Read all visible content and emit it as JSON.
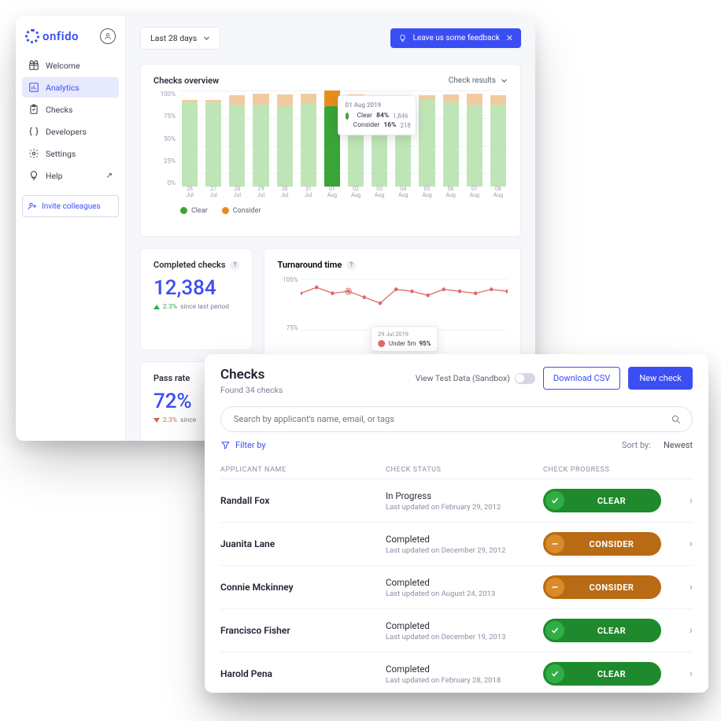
{
  "brand": {
    "name": "onfido"
  },
  "sidebar": {
    "items": [
      {
        "label": "Welcome",
        "icon": "gift-icon"
      },
      {
        "label": "Analytics",
        "icon": "bar-chart-icon",
        "active": true
      },
      {
        "label": "Checks",
        "icon": "clipboard-icon"
      },
      {
        "label": "Developers",
        "icon": "braces-icon"
      },
      {
        "label": "Settings",
        "icon": "gear-icon"
      },
      {
        "label": "Help",
        "icon": "bulb-icon",
        "external": true
      }
    ],
    "invite_label": "Invite colleagues"
  },
  "toolbar": {
    "range_label": "Last 28 days",
    "feedback_label": "Leave us some feedback"
  },
  "overview": {
    "title": "Checks overview",
    "results_label": "Check results",
    "y_ticks": [
      "100%",
      "75%",
      "50%",
      "25%",
      "0%"
    ],
    "legend_clear": "Clear",
    "legend_consider": "Consider"
  },
  "chart_data": {
    "type": "bar",
    "y_axis": "percent",
    "ylim": [
      0,
      100
    ],
    "categories": [
      {
        "d": "26",
        "m": "Jul"
      },
      {
        "d": "27",
        "m": "Jul"
      },
      {
        "d": "28",
        "m": "Jul"
      },
      {
        "d": "29",
        "m": "Jul"
      },
      {
        "d": "30",
        "m": "Jul"
      },
      {
        "d": "31",
        "m": "Jul"
      },
      {
        "d": "01",
        "m": "Aug"
      },
      {
        "d": "02",
        "m": "Aug"
      },
      {
        "d": "03",
        "m": "Aug"
      },
      {
        "d": "04",
        "m": "Aug"
      },
      {
        "d": "05",
        "m": "Aug"
      },
      {
        "d": "06",
        "m": "Aug"
      },
      {
        "d": "07",
        "m": "Aug"
      },
      {
        "d": "08",
        "m": "Aug"
      }
    ],
    "series": [
      {
        "name": "Clear",
        "values_pct": [
          88,
          88,
          85,
          85,
          84,
          87,
          84,
          84,
          86,
          85,
          90,
          88,
          85,
          85
        ]
      },
      {
        "name": "Consider",
        "values_pct": [
          2,
          2,
          10,
          12,
          12,
          10,
          16,
          12,
          8,
          10,
          5,
          8,
          12,
          10
        ]
      }
    ],
    "highlight_index": 6,
    "tooltip": {
      "date": "01 Aug 2019",
      "rows": [
        {
          "label": "Clear",
          "pct": "84%",
          "count": "1,846",
          "color": "#3aa537"
        },
        {
          "label": "Consider",
          "pct": "16%",
          "count": "218",
          "color": "#e88c1e"
        }
      ]
    }
  },
  "metrics": {
    "completed": {
      "title": "Completed checks",
      "value": "12,384",
      "delta_pct": "2.3%",
      "delta_dir": "up",
      "delta_note": "since last period"
    },
    "pass": {
      "title": "Pass rate",
      "value": "72%",
      "delta_pct": "2.3%",
      "delta_dir": "down",
      "delta_note": "since"
    }
  },
  "turnaround": {
    "title": "Turnaround time",
    "y_ticks": [
      "100%",
      "75%"
    ],
    "series": {
      "name": "Under 5m",
      "values_pct": [
        93,
        96,
        93,
        94,
        91,
        88,
        95,
        94,
        92,
        95,
        94,
        93,
        95,
        94
      ]
    },
    "tooltip": {
      "date": "29 Jul 2019",
      "label": "Under 5m",
      "pct": "95%"
    }
  },
  "checks_panel": {
    "title": "Checks",
    "subtitle": "Found 34 checks",
    "sandbox_label": "View Test Data (Sandbox)",
    "download_label": "Download CSV",
    "new_label": "New check",
    "search_placeholder": "Search by applicant's name, email, or tags",
    "filter_label": "Filter by",
    "sort_label": "Sort by:",
    "sort_value": "Newest",
    "columns": {
      "name": "APPLICANT NAME",
      "status": "CHECK STATUS",
      "progress": "CHECK PROGRESS"
    },
    "pill_labels": {
      "clear": "CLEAR",
      "consider": "CONSIDER"
    },
    "rows": [
      {
        "name": "Randall Fox",
        "status": "In Progress",
        "updated": "Last updated on February 29, 2012",
        "progress": "clear"
      },
      {
        "name": "Juanita Lane",
        "status": "Completed",
        "updated": "Last updated on December 29, 2012",
        "progress": "consider"
      },
      {
        "name": "Connie Mckinney",
        "status": "Completed",
        "updated": "Last updated on August 24, 2013",
        "progress": "consider"
      },
      {
        "name": "Francisco Fisher",
        "status": "Completed",
        "updated": "Last updated on December 19, 2013",
        "progress": "clear"
      },
      {
        "name": "Harold Pena",
        "status": "Completed",
        "updated": "Last updated on February 28, 2018",
        "progress": "clear"
      }
    ]
  }
}
